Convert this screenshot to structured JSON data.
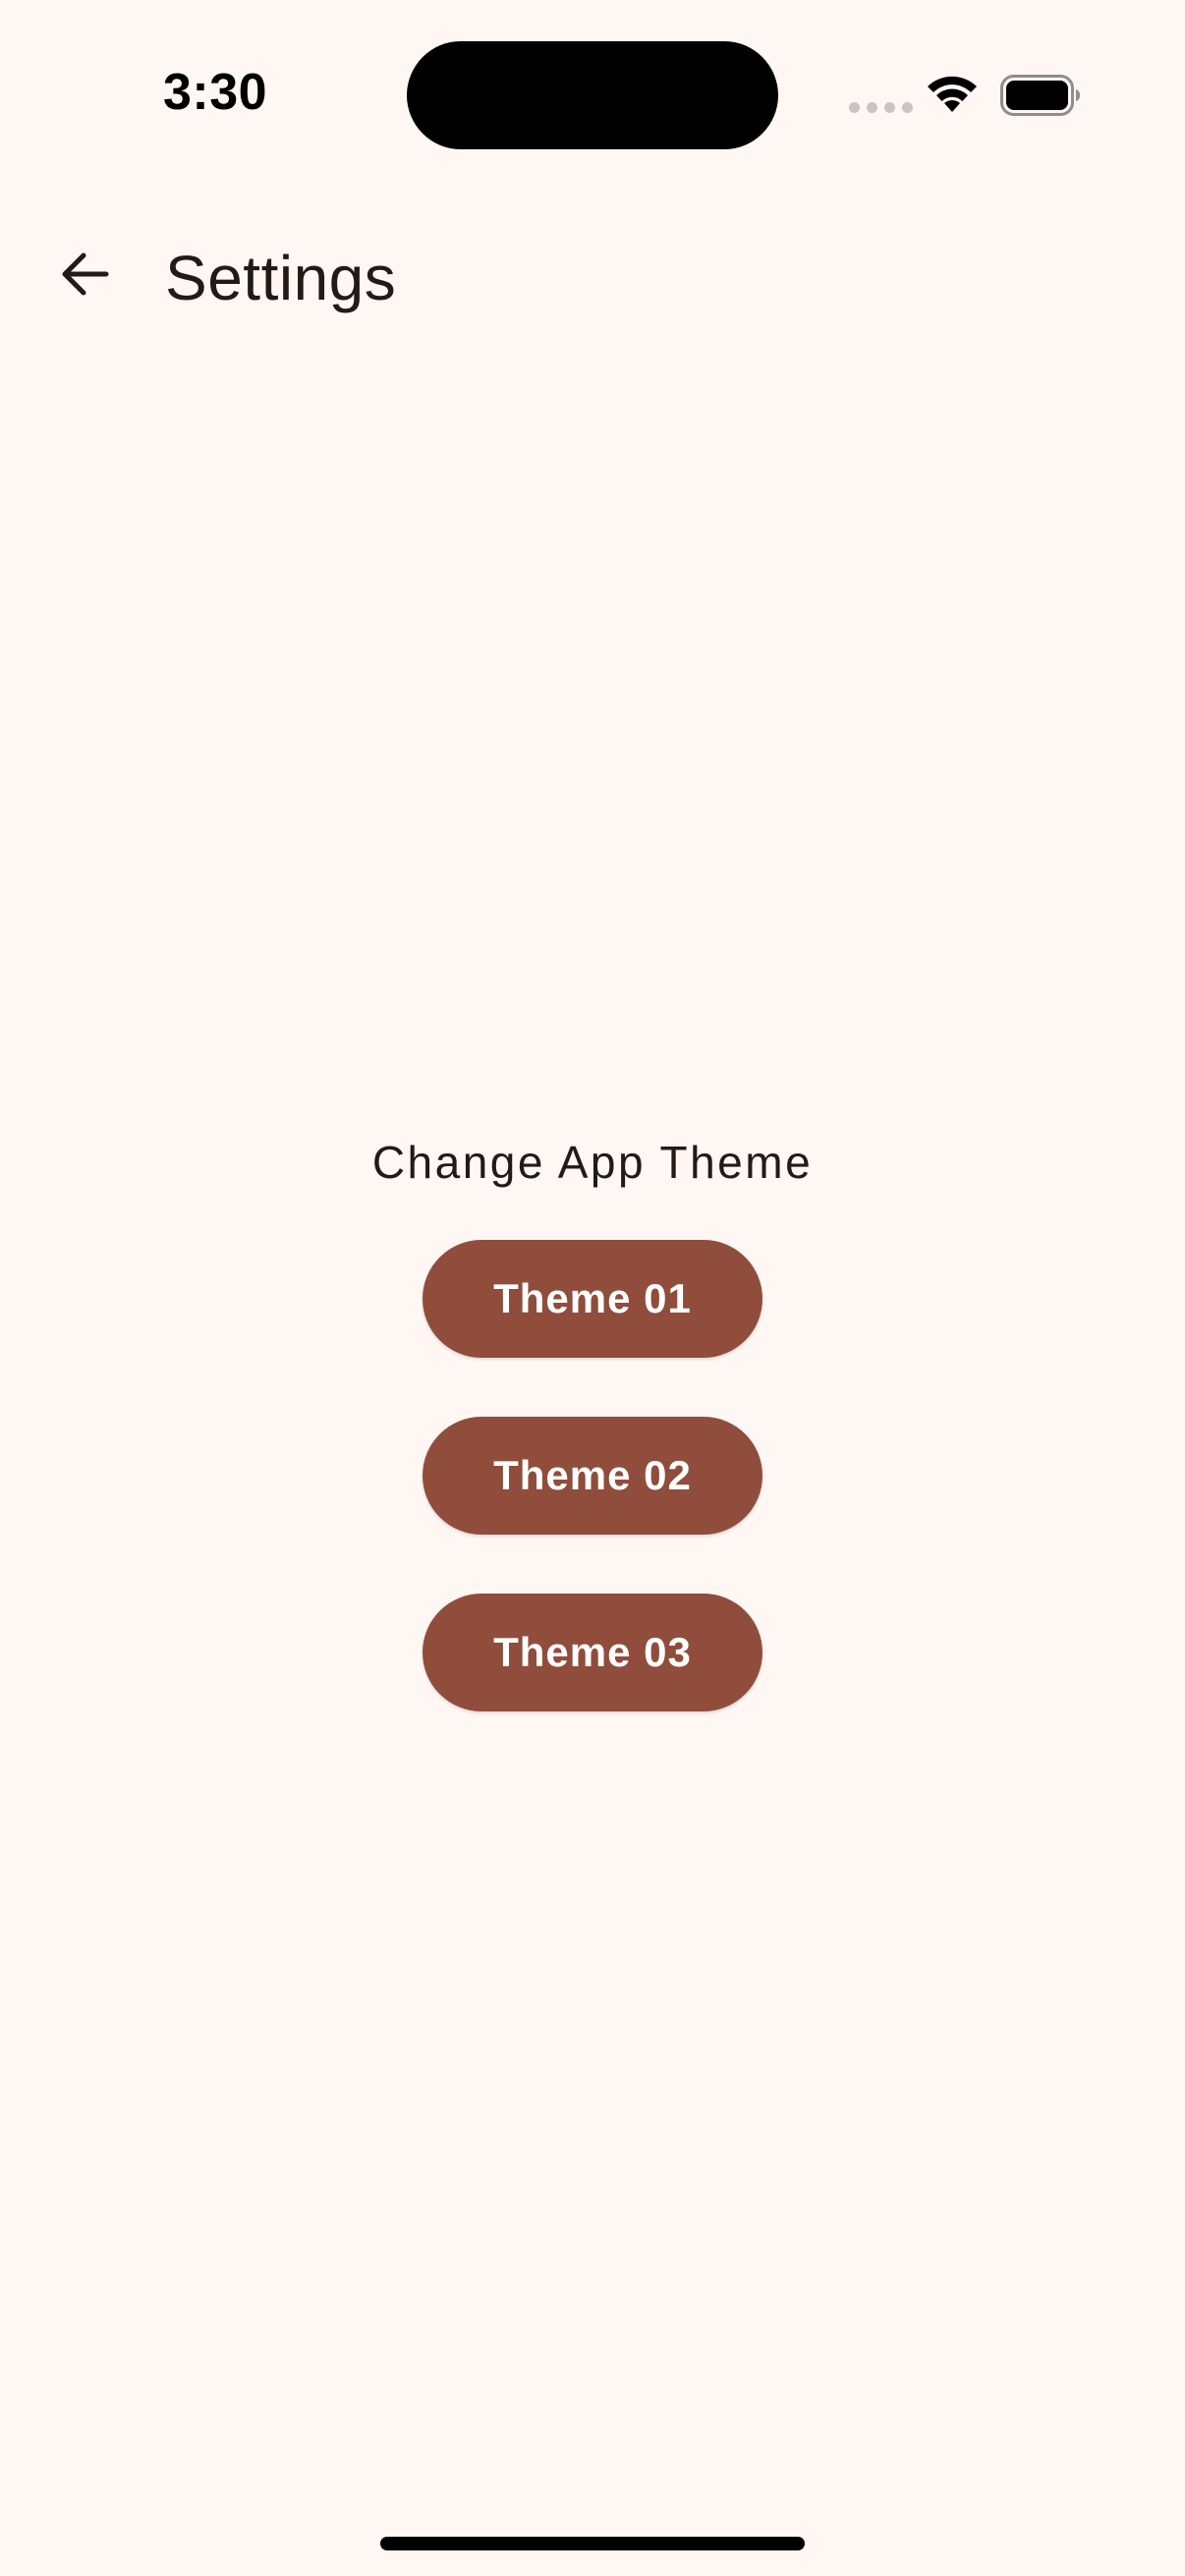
{
  "status_bar": {
    "time": "3:30"
  },
  "icons": {
    "back": "arrow-left-icon",
    "wifi": "wifi-icon",
    "battery": "battery-icon",
    "signal": "cellular-signal-icon"
  },
  "app_bar": {
    "title": "Settings"
  },
  "theme_section": {
    "label": "Change App Theme",
    "buttons": [
      {
        "label": "Theme 01"
      },
      {
        "label": "Theme 02"
      },
      {
        "label": "Theme 03"
      }
    ]
  },
  "colors": {
    "background": "#FFF7F4",
    "button": "#904D3C",
    "button_text": "#FFFFFF",
    "text": "#231A17"
  }
}
